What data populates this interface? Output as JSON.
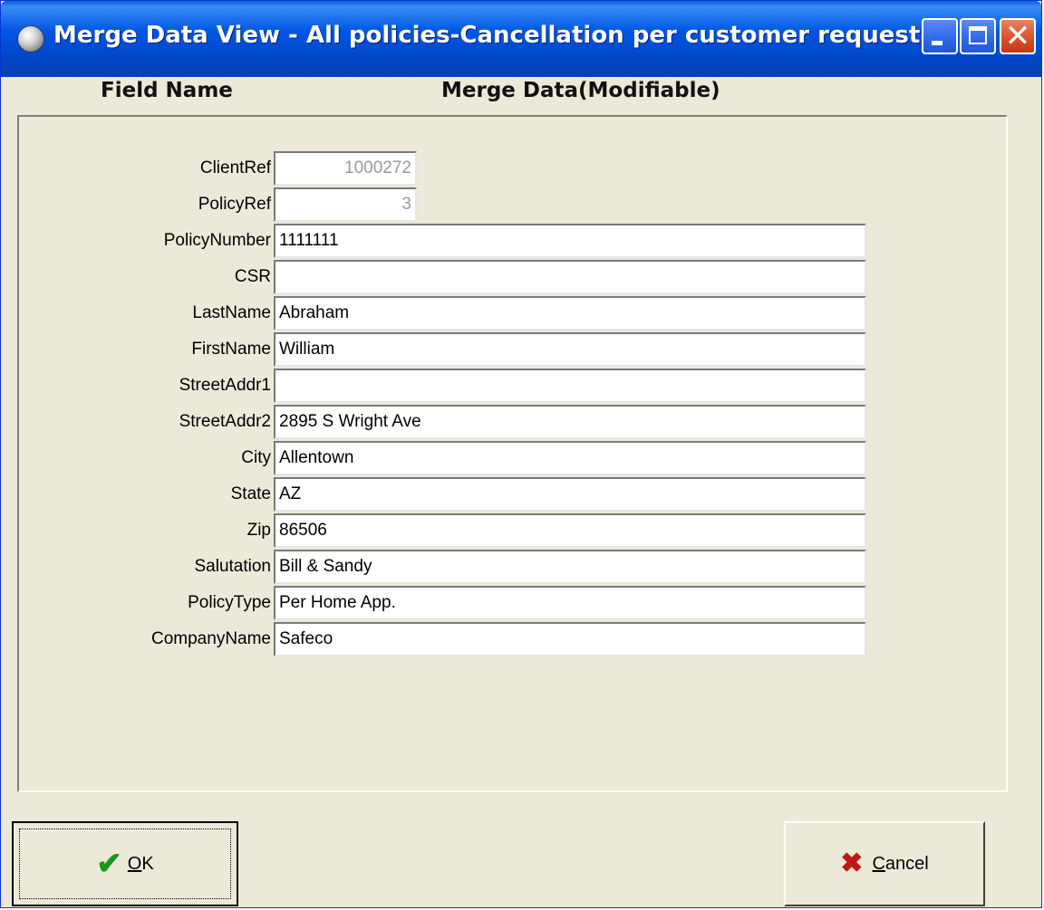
{
  "window": {
    "title": "Merge Data View - All policies-Cancellation per customer request",
    "controls": {
      "minimize_icon": "minimize-icon",
      "maximize_icon": "maximize-icon",
      "close_icon": "close-icon",
      "close_glyph": "✕"
    }
  },
  "headers": {
    "field_name": "Field Name",
    "merge_data": "Merge Data(Modifiable)"
  },
  "fields": [
    {
      "label": "ClientRef",
      "value": "1000272",
      "readonly": true
    },
    {
      "label": "PolicyRef",
      "value": "3",
      "readonly": true
    },
    {
      "label": "PolicyNumber",
      "value": "1111111",
      "readonly": false
    },
    {
      "label": "CSR",
      "value": "",
      "readonly": false
    },
    {
      "label": "LastName",
      "value": "Abraham",
      "readonly": false
    },
    {
      "label": "FirstName",
      "value": "William",
      "readonly": false
    },
    {
      "label": "StreetAddr1",
      "value": "",
      "readonly": false
    },
    {
      "label": "StreetAddr2",
      "value": "2895 S Wright Ave",
      "readonly": false
    },
    {
      "label": "City",
      "value": "Allentown",
      "readonly": false
    },
    {
      "label": "State",
      "value": "AZ",
      "readonly": false
    },
    {
      "label": "Zip",
      "value": "86506",
      "readonly": false
    },
    {
      "label": "Salutation",
      "value": "Bill & Sandy",
      "readonly": false
    },
    {
      "label": "PolicyType",
      "value": "Per Home App.",
      "readonly": false
    },
    {
      "label": "CompanyName",
      "value": "Safeco",
      "readonly": false
    }
  ],
  "buttons": {
    "ok": {
      "label": "OK",
      "icon": "checkmark-icon",
      "icon_glyph": "✔"
    },
    "cancel": {
      "label": "Cancel",
      "icon": "x-icon",
      "icon_glyph": "✖"
    }
  },
  "colors": {
    "titlebar": "#0055e5",
    "dialog_bg": "#ece9d8",
    "readonly_text": "#9a9a9a",
    "ok_icon": "#1a9a1a",
    "cancel_icon": "#c01818"
  }
}
